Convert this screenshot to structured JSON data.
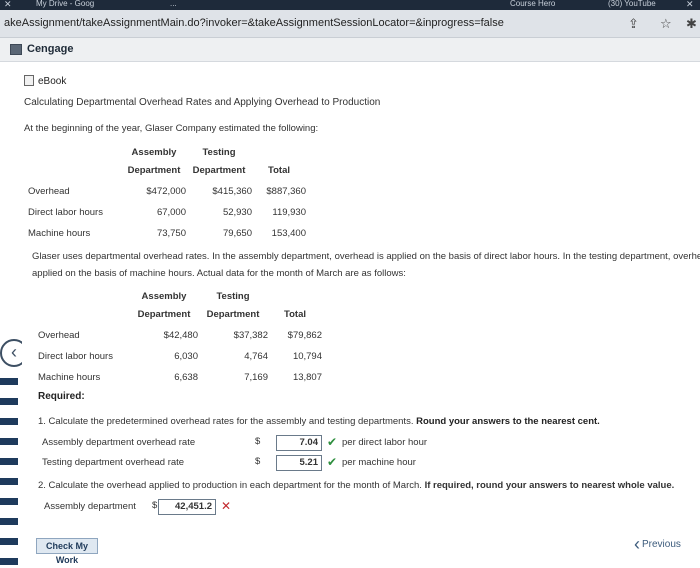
{
  "browser": {
    "tabs": [
      "My Drive - Goog",
      "...",
      "Course Hero",
      "(30) YouTube"
    ],
    "url": "akeAssignment/takeAssignmentMain.do?invoker=&takeAssignmentSessionLocator=&inprogress=false"
  },
  "cengage": {
    "label": "Cengage"
  },
  "ebook": {
    "label": "eBook"
  },
  "doc": {
    "title": "Calculating Departmental Overhead Rates and Applying Overhead to Production",
    "intro": "At the beginning of the year, Glaser Company estimated the following:"
  },
  "estimated": {
    "headers": {
      "assembly_top": "Assembly",
      "testing_top": "Testing",
      "assembly_bottom": "Department",
      "testing_bottom": "Department",
      "total": "Total"
    },
    "rows": [
      {
        "label": "Overhead",
        "assembly": "$472,000",
        "testing": "$415,360",
        "total": "$887,360"
      },
      {
        "label": "Direct labor hours",
        "assembly": "67,000",
        "testing": "52,930",
        "total": "119,930"
      },
      {
        "label": "Machine hours",
        "assembly": "73,750",
        "testing": "79,650",
        "total": "153,400"
      }
    ]
  },
  "paragraph": {
    "line1": "Glaser uses departmental overhead rates. In the assembly department, overhead is applied on the basis of direct labor hours. In the testing department, overhead is",
    "line2": "applied on the basis of machine hours. Actual data for the month of March are as follows:"
  },
  "actual": {
    "headers": {
      "assembly_top": "Assembly",
      "testing_top": "Testing",
      "assembly_bottom": "Department",
      "testing_bottom": "Department",
      "total": "Total"
    },
    "rows": [
      {
        "label": "Overhead",
        "assembly": "$42,480",
        "testing": "$37,382",
        "total": "$79,862"
      },
      {
        "label": "Direct labor hours",
        "assembly": "6,030",
        "testing": "4,764",
        "total": "10,794"
      },
      {
        "label": "Machine hours",
        "assembly": "6,638",
        "testing": "7,169",
        "total": "13,807"
      }
    ]
  },
  "required": {
    "label": "Required:",
    "q1_text": "1.  Calculate the predetermined overhead rates for the assembly and testing departments. ",
    "q1_bold": "Round your answers to the nearest cent.",
    "assembly_rate": {
      "label": "Assembly department overhead rate",
      "currency": "$",
      "value": "7.04",
      "unit": "per direct labor hour"
    },
    "testing_rate": {
      "label": "Testing department overhead rate",
      "currency": "$",
      "value": "5.21",
      "unit": "per machine hour"
    },
    "q2_text": "2.  Calculate the overhead applied to production in each department for the month of March. ",
    "q2_bold": "If required, round your answers to nearest whole value.",
    "assembly_applied": {
      "label": "Assembly department",
      "currency": "$",
      "value": "42,451.2"
    }
  },
  "buttons": {
    "check": "Check My Work",
    "previous": "Previous"
  },
  "colors": {
    "correct": "#2f8f3f",
    "incorrect": "#c2292e",
    "rail": "#1e3a5c"
  },
  "icons": [
    "close-icon",
    "share-icon",
    "star-icon",
    "extension-icon",
    "ebook-icon",
    "chevron-left-icon",
    "check-icon",
    "x-icon"
  ]
}
